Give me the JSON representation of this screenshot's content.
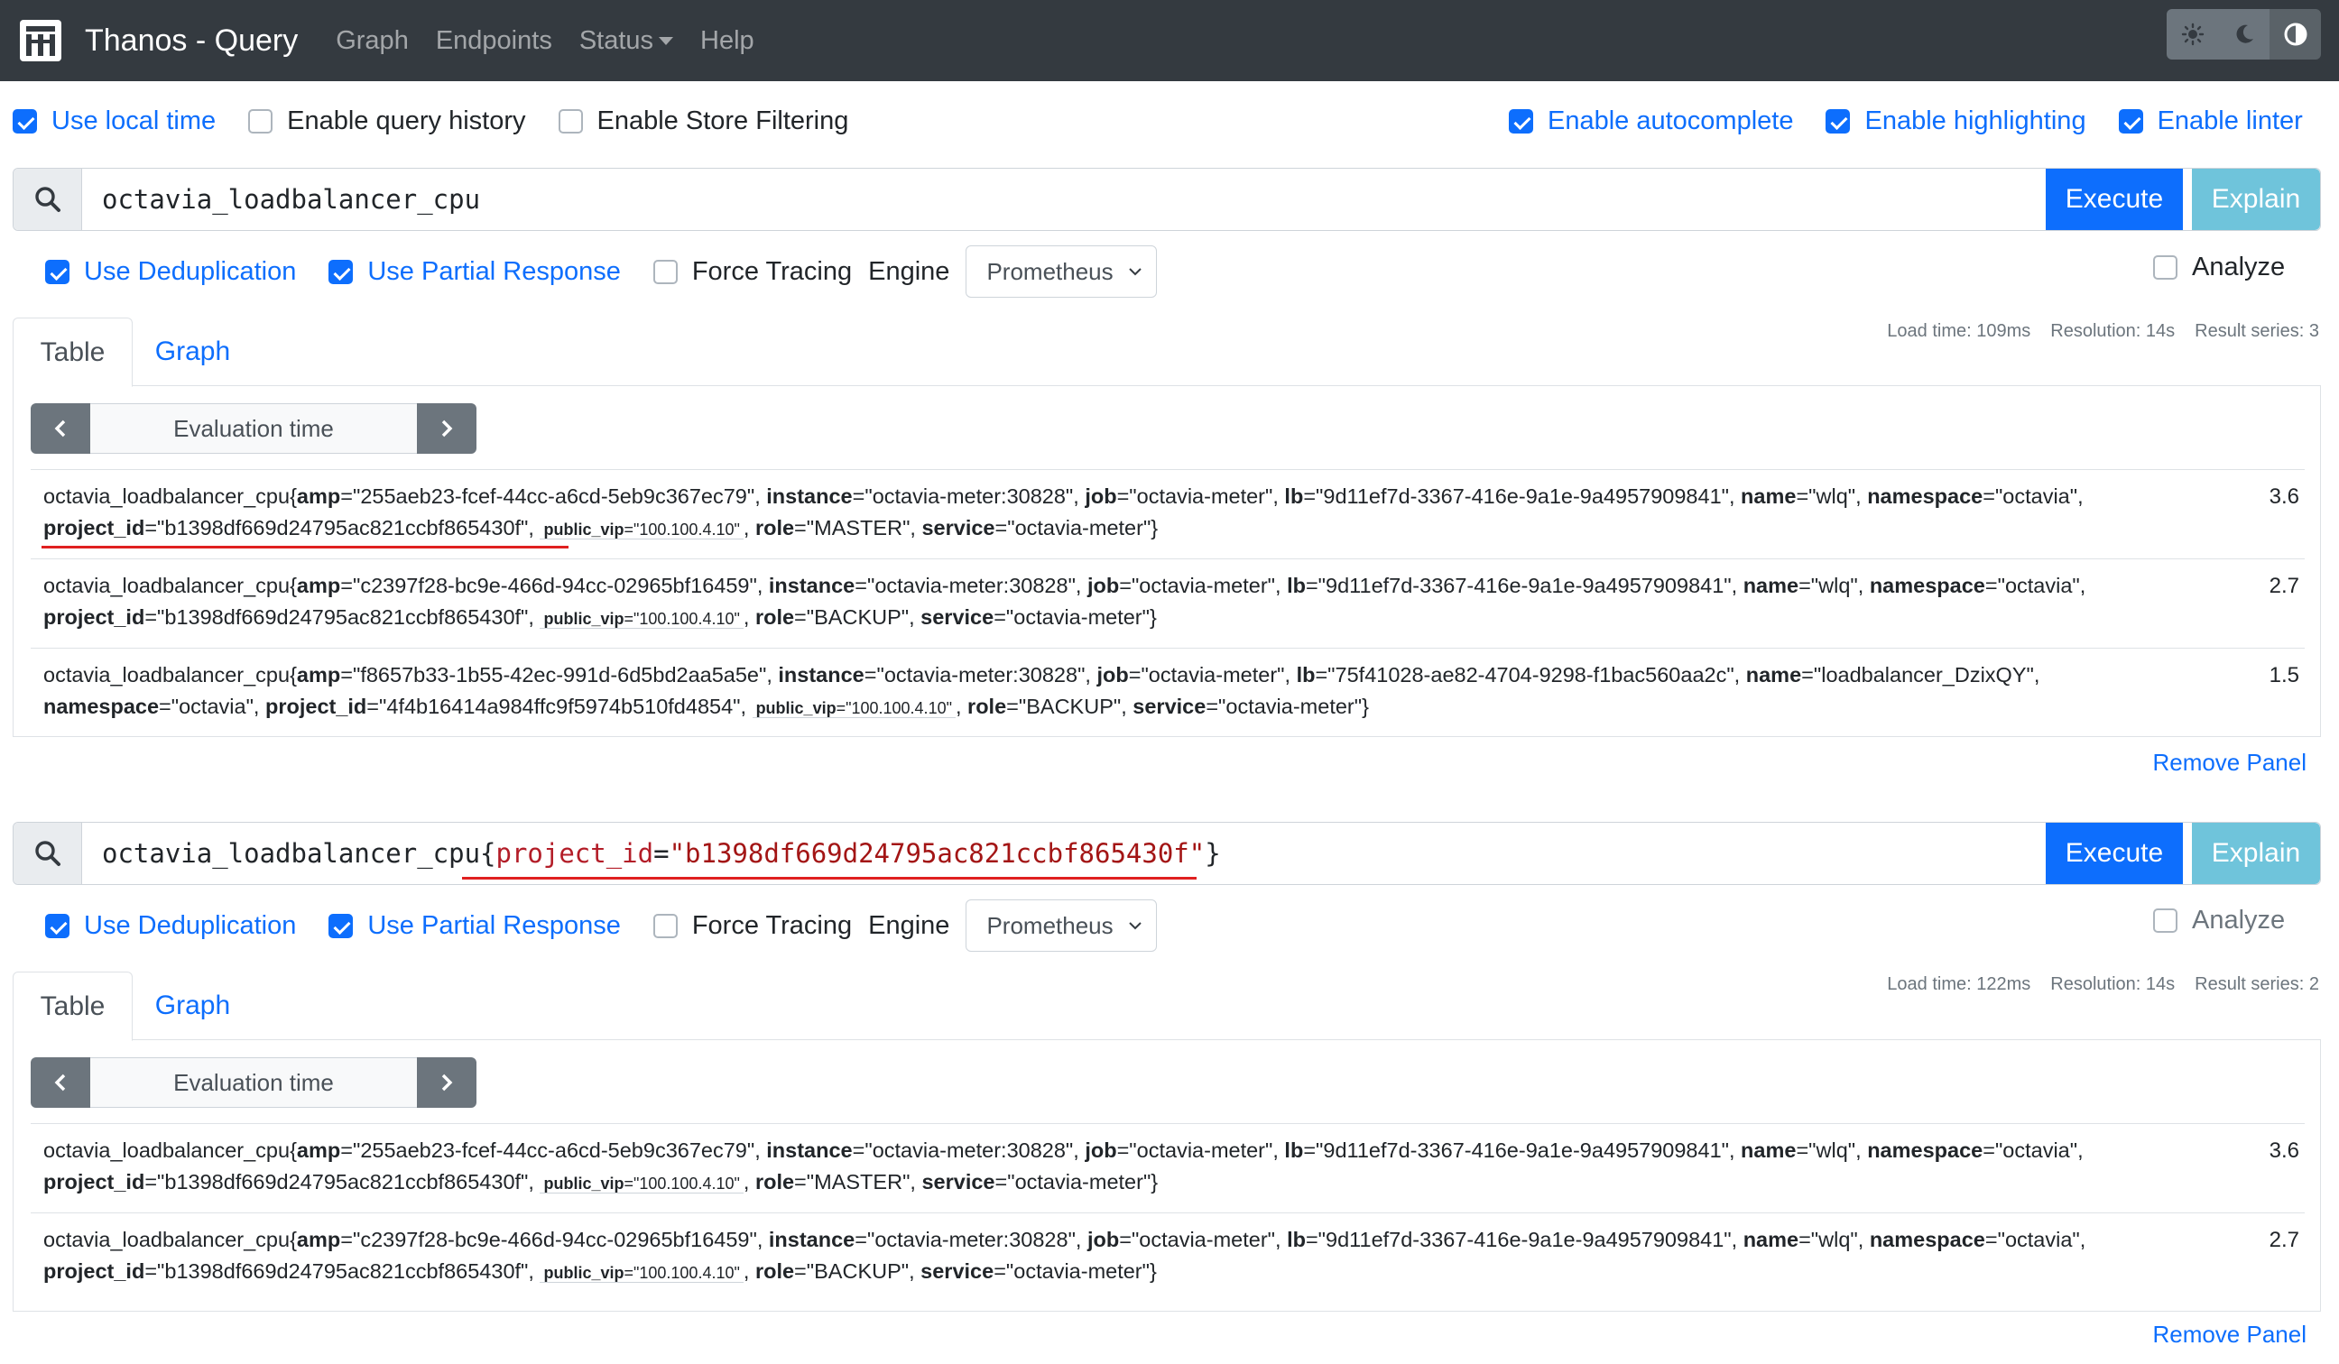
{
  "nav": {
    "brand": "Thanos - Query",
    "links": [
      "Graph",
      "Endpoints",
      "Status",
      "Help"
    ]
  },
  "options": {
    "use_local_time": "Use local time",
    "enable_query_history": "Enable query history",
    "enable_store_filtering": "Enable Store Filtering",
    "enable_autocomplete": "Enable autocomplete",
    "enable_highlighting": "Enable highlighting",
    "enable_linter": "Enable linter"
  },
  "labels": {
    "execute": "Execute",
    "explain": "Explain",
    "use_dedup": "Use Deduplication",
    "use_partial": "Use Partial Response",
    "force_tracing": "Force Tracing",
    "engine": "Engine",
    "engine_value": "Prometheus",
    "analyze": "Analyze",
    "tab_table": "Table",
    "tab_graph": "Graph",
    "eval_time": "Evaluation time",
    "remove_panel": "Remove Panel"
  },
  "colors": {
    "accent": "#0d6efd",
    "navbar": "#343a40",
    "explain": "#6fc4db",
    "highlight_underline": "#e02020"
  },
  "panels": [
    {
      "expr_plain": "octavia_loadbalancer_cpu",
      "stats": {
        "load": "Load time: 109ms",
        "resolution": "Resolution: 14s",
        "series": "Result series: 3"
      },
      "results": [
        {
          "metric": "octavia_loadbalancer_cpu",
          "amp": "255aeb23-fcef-44cc-a6cd-5eb9c367ec79",
          "instance": "octavia-meter:30828",
          "job": "octavia-meter",
          "lb": "9d11ef7d-3367-416e-9a1e-9a4957909841",
          "name": "wlq",
          "namespace": "octavia",
          "project_id": "b1398df669d24795ac821ccbf865430f",
          "public_vip": "100.100.4.10",
          "role": "MASTER",
          "service": "octavia-meter",
          "value": "3.6"
        },
        {
          "metric": "octavia_loadbalancer_cpu",
          "amp": "c2397f28-bc9e-466d-94cc-02965bf16459",
          "instance": "octavia-meter:30828",
          "job": "octavia-meter",
          "lb": "9d11ef7d-3367-416e-9a1e-9a4957909841",
          "name": "wlq",
          "namespace": "octavia",
          "project_id": "b1398df669d24795ac821ccbf865430f",
          "public_vip": "100.100.4.10",
          "role": "BACKUP",
          "service": "octavia-meter",
          "value": "2.7"
        },
        {
          "metric": "octavia_loadbalancer_cpu",
          "amp": "f8657b33-1b55-42ec-991d-6d5bd2aa5a5e",
          "instance": "octavia-meter:30828",
          "job": "octavia-meter",
          "lb": "75f41028-ae82-4704-9298-f1bac560aa2c",
          "name": "loadbalancer_DzixQY",
          "namespace": "octavia",
          "project_id": "4f4b16414a984ffc9f5974b510fd4854",
          "public_vip": "100.100.4.10",
          "role": "BACKUP",
          "service": "octavia-meter",
          "value": "1.5"
        }
      ]
    },
    {
      "expr_metric": "octavia_loadbalancer_cpu",
      "expr_open": "{",
      "expr_label": "project_id",
      "expr_eq": "=",
      "expr_value": "\"b1398df669d24795ac821ccbf865430f\"",
      "expr_close": "}",
      "stats": {
        "load": "Load time: 122ms",
        "resolution": "Resolution: 14s",
        "series": "Result series: 2"
      },
      "results": [
        {
          "metric": "octavia_loadbalancer_cpu",
          "amp": "255aeb23-fcef-44cc-a6cd-5eb9c367ec79",
          "instance": "octavia-meter:30828",
          "job": "octavia-meter",
          "lb": "9d11ef7d-3367-416e-9a1e-9a4957909841",
          "name": "wlq",
          "namespace": "octavia",
          "project_id": "b1398df669d24795ac821ccbf865430f",
          "public_vip": "100.100.4.10",
          "role": "MASTER",
          "service": "octavia-meter",
          "value": "3.6"
        },
        {
          "metric": "octavia_loadbalancer_cpu",
          "amp": "c2397f28-bc9e-466d-94cc-02965bf16459",
          "instance": "octavia-meter:30828",
          "job": "octavia-meter",
          "lb": "9d11ef7d-3367-416e-9a1e-9a4957909841",
          "name": "wlq",
          "namespace": "octavia",
          "project_id": "b1398df669d24795ac821ccbf865430f",
          "public_vip": "100.100.4.10",
          "role": "BACKUP",
          "service": "octavia-meter",
          "value": "2.7"
        }
      ]
    }
  ]
}
